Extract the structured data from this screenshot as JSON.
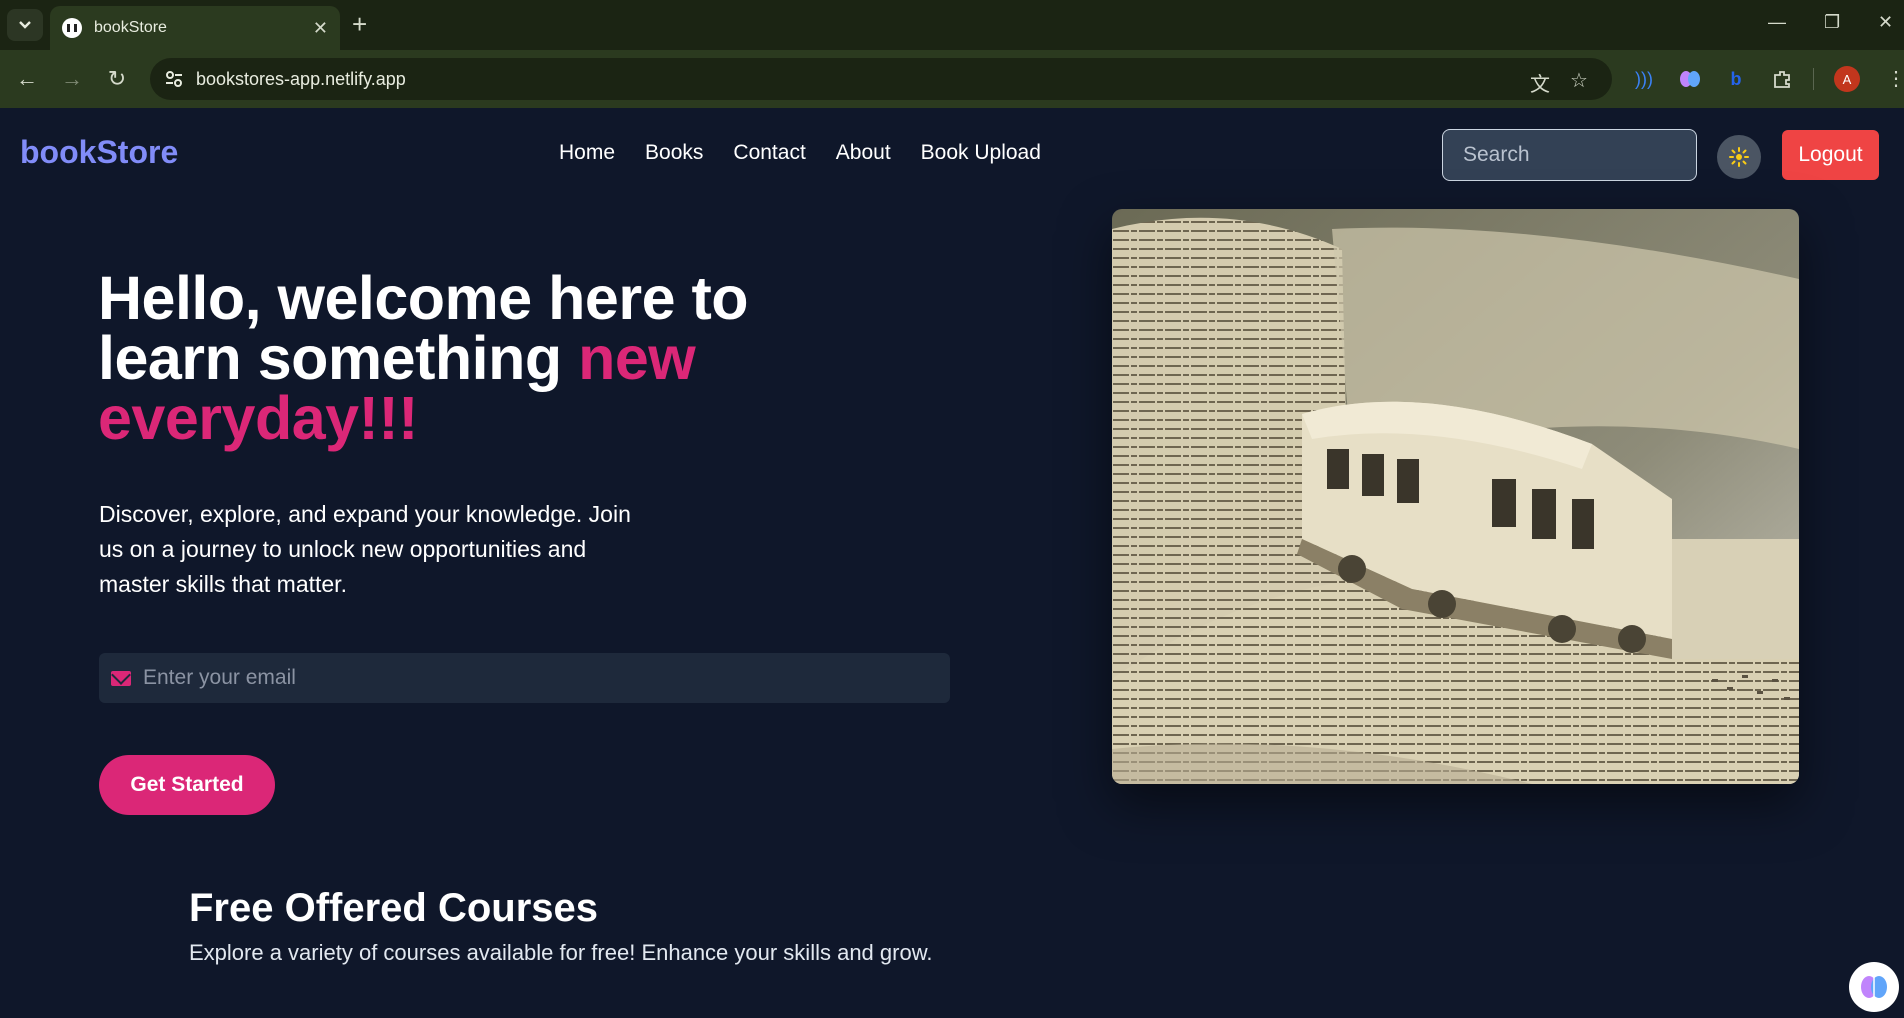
{
  "browser": {
    "tab_title": "bookStore",
    "url": "bookstores-app.netlify.app",
    "profile_initial": "A",
    "icons": [
      "tab-search-icon",
      "close-icon",
      "new-tab-icon",
      "minimize-icon",
      "restore-icon",
      "close-window-icon",
      "back-icon",
      "forward-icon",
      "reload-icon",
      "site-settings-icon",
      "translate-icon",
      "bookmark-star-icon",
      "extensions-icon",
      "menu-icon"
    ]
  },
  "header": {
    "logo": "bookStore",
    "nav": [
      "Home",
      "Books",
      "Contact",
      "About",
      "Book Upload"
    ],
    "search_placeholder": "Search",
    "logout_label": "Logout"
  },
  "hero": {
    "title_part1": "Hello, welcome here to learn something ",
    "title_accent": "new everyday!!!",
    "description": "Discover, explore, and expand your knowledge. Join us on a journey to unlock new opportunities and master skills that matter.",
    "email_placeholder": "Enter your email",
    "cta_label": "Get Started"
  },
  "courses": {
    "title": "Free Offered Courses",
    "description": "Explore a variety of courses available for free! Enhance your skills and grow."
  },
  "colors": {
    "background": "#0f172a",
    "logo": "#818cf8",
    "accent": "#db2777",
    "logout": "#ef4444",
    "browser_chrome": "#2b3a1f"
  }
}
